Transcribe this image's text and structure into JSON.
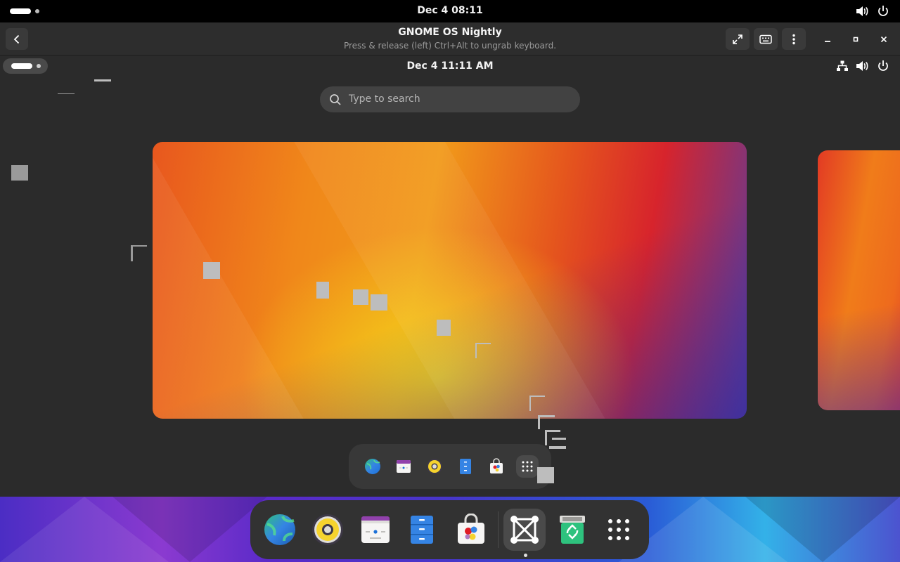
{
  "host": {
    "clock": "Dec 4  08:11",
    "tray_icons": [
      "volume-icon",
      "power-icon"
    ]
  },
  "vm_window": {
    "title": "GNOME OS Nightly",
    "subtitle": "Press & release (left) Ctrl+Alt to ungrab keyboard.",
    "header_buttons": [
      "fullscreen-icon",
      "keyboard-icon",
      "menu-icon"
    ],
    "window_controls": [
      "minimize-icon",
      "maximize-icon",
      "close-icon"
    ]
  },
  "guest": {
    "clock": "Dec 4  11:11 AM",
    "tray_icons": [
      "network-icon",
      "volume-icon",
      "power-icon"
    ],
    "search": {
      "placeholder": "Type to search"
    },
    "mini_dock": [
      "web-browser",
      "calendar",
      "music",
      "files",
      "software",
      "show-apps"
    ],
    "dock": {
      "items": [
        "web-browser",
        "music",
        "calendar",
        "files",
        "software",
        "boxes",
        "trash",
        "show-apps"
      ],
      "running": "boxes"
    }
  },
  "colors": {
    "host_bar": "#000000",
    "header": "#2d2d2d",
    "overview_bg": "#2b2b2b",
    "dock_bg": "#323232",
    "accent_orange": "#f08a1a",
    "accent_red": "#d7242c"
  }
}
